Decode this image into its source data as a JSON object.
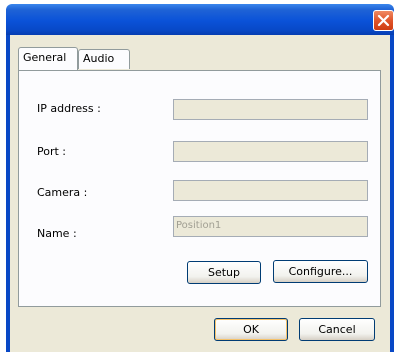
{
  "dialog": {
    "close_glyph": "✕"
  },
  "tabs": [
    {
      "label": "General",
      "active": true
    },
    {
      "label": "Audio",
      "active": false
    }
  ],
  "general": {
    "ip_address": {
      "label": "IP address :",
      "value": ""
    },
    "port": {
      "label": "Port :",
      "value": ""
    },
    "camera": {
      "label": "Camera :",
      "value": ""
    },
    "name": {
      "label": "Name :",
      "value": "Position1"
    },
    "setup_label": "Setup",
    "configure_label": "Configure..."
  },
  "footer": {
    "ok_label": "OK",
    "cancel_label": "Cancel"
  },
  "colors": {
    "titlebar": "#0a52d8",
    "close_button": "#e0552b",
    "dialog_face": "#ece9d8",
    "tab_border": "#919b9c",
    "button_border": "#003c74"
  }
}
